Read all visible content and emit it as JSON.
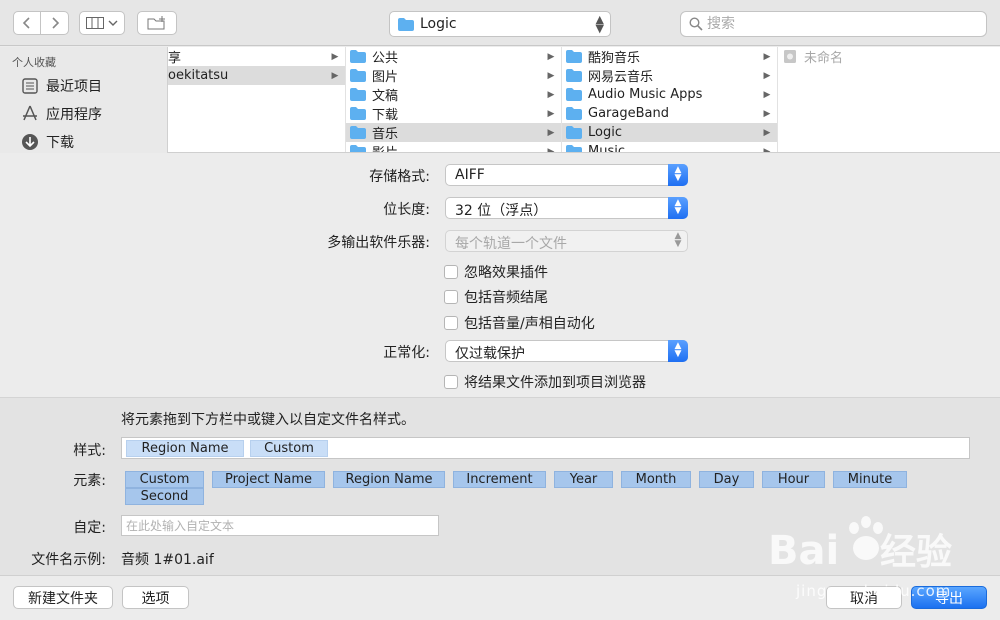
{
  "toolbar": {
    "location": "Logic",
    "search_placeholder": "搜索"
  },
  "sidebar": {
    "heading": "个人收藏",
    "items": [
      {
        "label": "最近项目",
        "icon": "recents-icon"
      },
      {
        "label": "应用程序",
        "icon": "applications-icon"
      },
      {
        "label": "下载",
        "icon": "downloads-icon"
      }
    ]
  },
  "columns": {
    "col1": [
      {
        "label": "享",
        "selected": false
      },
      {
        "label": "oekitatsu",
        "selected": true
      }
    ],
    "col2": [
      {
        "label": "公共",
        "selected": false
      },
      {
        "label": "图片",
        "selected": false
      },
      {
        "label": "文稿",
        "selected": false
      },
      {
        "label": "下载",
        "selected": false
      },
      {
        "label": "音乐",
        "selected": true
      },
      {
        "label": "影片",
        "selected": false
      }
    ],
    "col3": [
      {
        "label": "酷狗音乐",
        "selected": false
      },
      {
        "label": "网易云音乐",
        "selected": false
      },
      {
        "label": "Audio Music Apps",
        "selected": false
      },
      {
        "label": "GarageBand",
        "selected": false
      },
      {
        "label": "Logic",
        "selected": true
      },
      {
        "label": "Music",
        "selected": false
      }
    ],
    "col4": [
      {
        "label": "未命名",
        "selected": false
      }
    ]
  },
  "options": {
    "format_label": "存储格式:",
    "format_value": "AIFF",
    "bitdepth_label": "位长度:",
    "bitdepth_value": "32 位（浮点）",
    "multiout_label": "多输出软件乐器:",
    "multiout_value": "每个轨道一个文件",
    "chk_ignore_fx": "忽略效果插件",
    "chk_include_tail": "包括音频结尾",
    "chk_include_automation": "包括音量/声相自动化",
    "normalize_label": "正常化:",
    "normalize_value": "仅过载保护",
    "chk_add_to_browser": "将结果文件添加到项目浏览器"
  },
  "naming": {
    "instruction": "将元素拖到下方栏中或键入以自定文件名样式。",
    "style_label": "样式:",
    "style_tokens": [
      "Region Name",
      "Custom"
    ],
    "elements_label": "元素:",
    "elements": [
      "Custom",
      "Project Name",
      "Region Name",
      "Increment",
      "Year",
      "Month",
      "Day",
      "Hour",
      "Minute",
      "Second"
    ],
    "custom_label": "自定:",
    "custom_placeholder": "在此处输入自定文本",
    "example_label": "文件名示例:",
    "example_value": "音频 1#01.aif"
  },
  "footer": {
    "new_folder": "新建文件夹",
    "options": "选项",
    "cancel": "取消",
    "export": "导出"
  },
  "watermark": {
    "text": "jingyan.baidu.com"
  },
  "colors": {
    "accent": "#1e6ff2",
    "folder": "#5db0f0",
    "token": "#a6c6ec"
  }
}
